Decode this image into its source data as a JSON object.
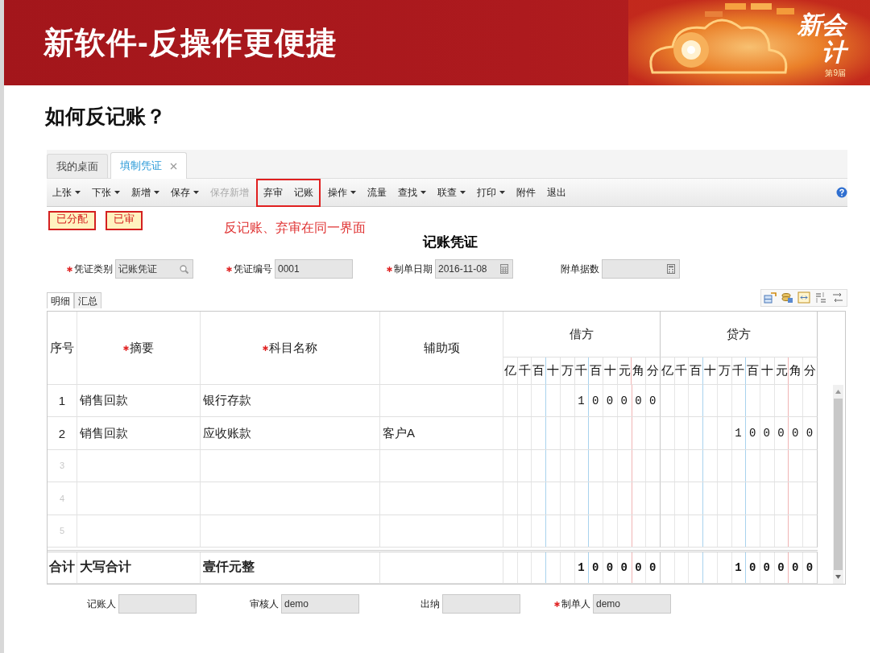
{
  "slide": {
    "title": "新软件-反操作更便捷",
    "logo": {
      "main": "新会计",
      "edition": "第9届"
    },
    "subtitle": "如何反记账？"
  },
  "app": {
    "tabs": [
      {
        "label": "我的桌面",
        "selected": false,
        "closable": false
      },
      {
        "label": "填制凭证",
        "selected": true,
        "closable": true
      }
    ],
    "toolbar": [
      {
        "label": "上张",
        "dropdown": true,
        "disabled": false,
        "highlighted": false
      },
      {
        "label": "下张",
        "dropdown": true,
        "disabled": false,
        "highlighted": false
      },
      {
        "label": "新增",
        "dropdown": true,
        "disabled": false,
        "highlighted": false
      },
      {
        "label": "保存",
        "dropdown": true,
        "disabled": false,
        "highlighted": false
      },
      {
        "label": "保存新增",
        "dropdown": false,
        "disabled": true,
        "highlighted": false
      },
      {
        "label": "弃审",
        "dropdown": false,
        "disabled": false,
        "highlighted": true
      },
      {
        "label": "记账",
        "dropdown": false,
        "disabled": false,
        "highlighted": true
      },
      {
        "label": "操作",
        "dropdown": true,
        "disabled": false,
        "highlighted": false
      },
      {
        "label": "流量",
        "dropdown": false,
        "disabled": false,
        "highlighted": false
      },
      {
        "label": "查找",
        "dropdown": true,
        "disabled": false,
        "highlighted": false
      },
      {
        "label": "联查",
        "dropdown": true,
        "disabled": false,
        "highlighted": false
      },
      {
        "label": "打印",
        "dropdown": true,
        "disabled": false,
        "highlighted": false
      },
      {
        "label": "附件",
        "dropdown": false,
        "disabled": false,
        "highlighted": false
      },
      {
        "label": "退出",
        "dropdown": false,
        "disabled": false,
        "highlighted": false
      }
    ],
    "status_badges": [
      "已分配",
      "已审"
    ],
    "annotation": "反记账、弃审在同一界面",
    "voucher_title": "记账凭证",
    "header_fields": [
      {
        "label": "凭证类别",
        "required": true,
        "value": "记账凭证",
        "kind": "lookup"
      },
      {
        "label": "凭证编号",
        "required": true,
        "value": "0001",
        "kind": "text"
      },
      {
        "label": "制单日期",
        "required": true,
        "value": "2016-11-08",
        "kind": "date"
      },
      {
        "label": "附单据数",
        "required": false,
        "kind": "calc"
      }
    ],
    "detail_tabs": [
      {
        "label": "明细",
        "selected": true
      },
      {
        "label": "汇总",
        "selected": false
      }
    ],
    "grid": {
      "columns": [
        {
          "label": "序号",
          "required": false
        },
        {
          "label": "摘要",
          "required": true
        },
        {
          "label": "科目名称",
          "required": true
        },
        {
          "label": "辅助项",
          "required": false
        }
      ],
      "amount_columns": [
        {
          "label": "借方",
          "units": [
            "亿",
            "千",
            "百",
            "十",
            "万",
            "千",
            "百",
            "十",
            "元",
            "角",
            "分"
          ]
        },
        {
          "label": "贷方",
          "units": [
            "亿",
            "千",
            "百",
            "十",
            "万",
            "千",
            "百",
            "十",
            "元",
            "角",
            "分"
          ]
        }
      ],
      "rows": [
        {
          "index": "1",
          "summary": "销售回款",
          "account": "银行存款",
          "debit": "100000"
        },
        {
          "index": "2",
          "summary": "销售回款",
          "account": "应收账款",
          "auxiliary": "客户A",
          "credit": "100000"
        },
        {
          "index": "3"
        },
        {
          "index": "4"
        },
        {
          "index": "5"
        }
      ],
      "total": {
        "label": "合计",
        "caption": "大写合计",
        "amount_in_words": "壹仟元整",
        "debit": "100000",
        "credit": "100000"
      }
    },
    "footer_fields": [
      {
        "label": "记账人",
        "required": false
      },
      {
        "label": "审核人",
        "required": false,
        "value": "demo"
      },
      {
        "label": "出纳",
        "required": false
      },
      {
        "label": "制单人",
        "required": true,
        "value": "demo"
      }
    ]
  }
}
